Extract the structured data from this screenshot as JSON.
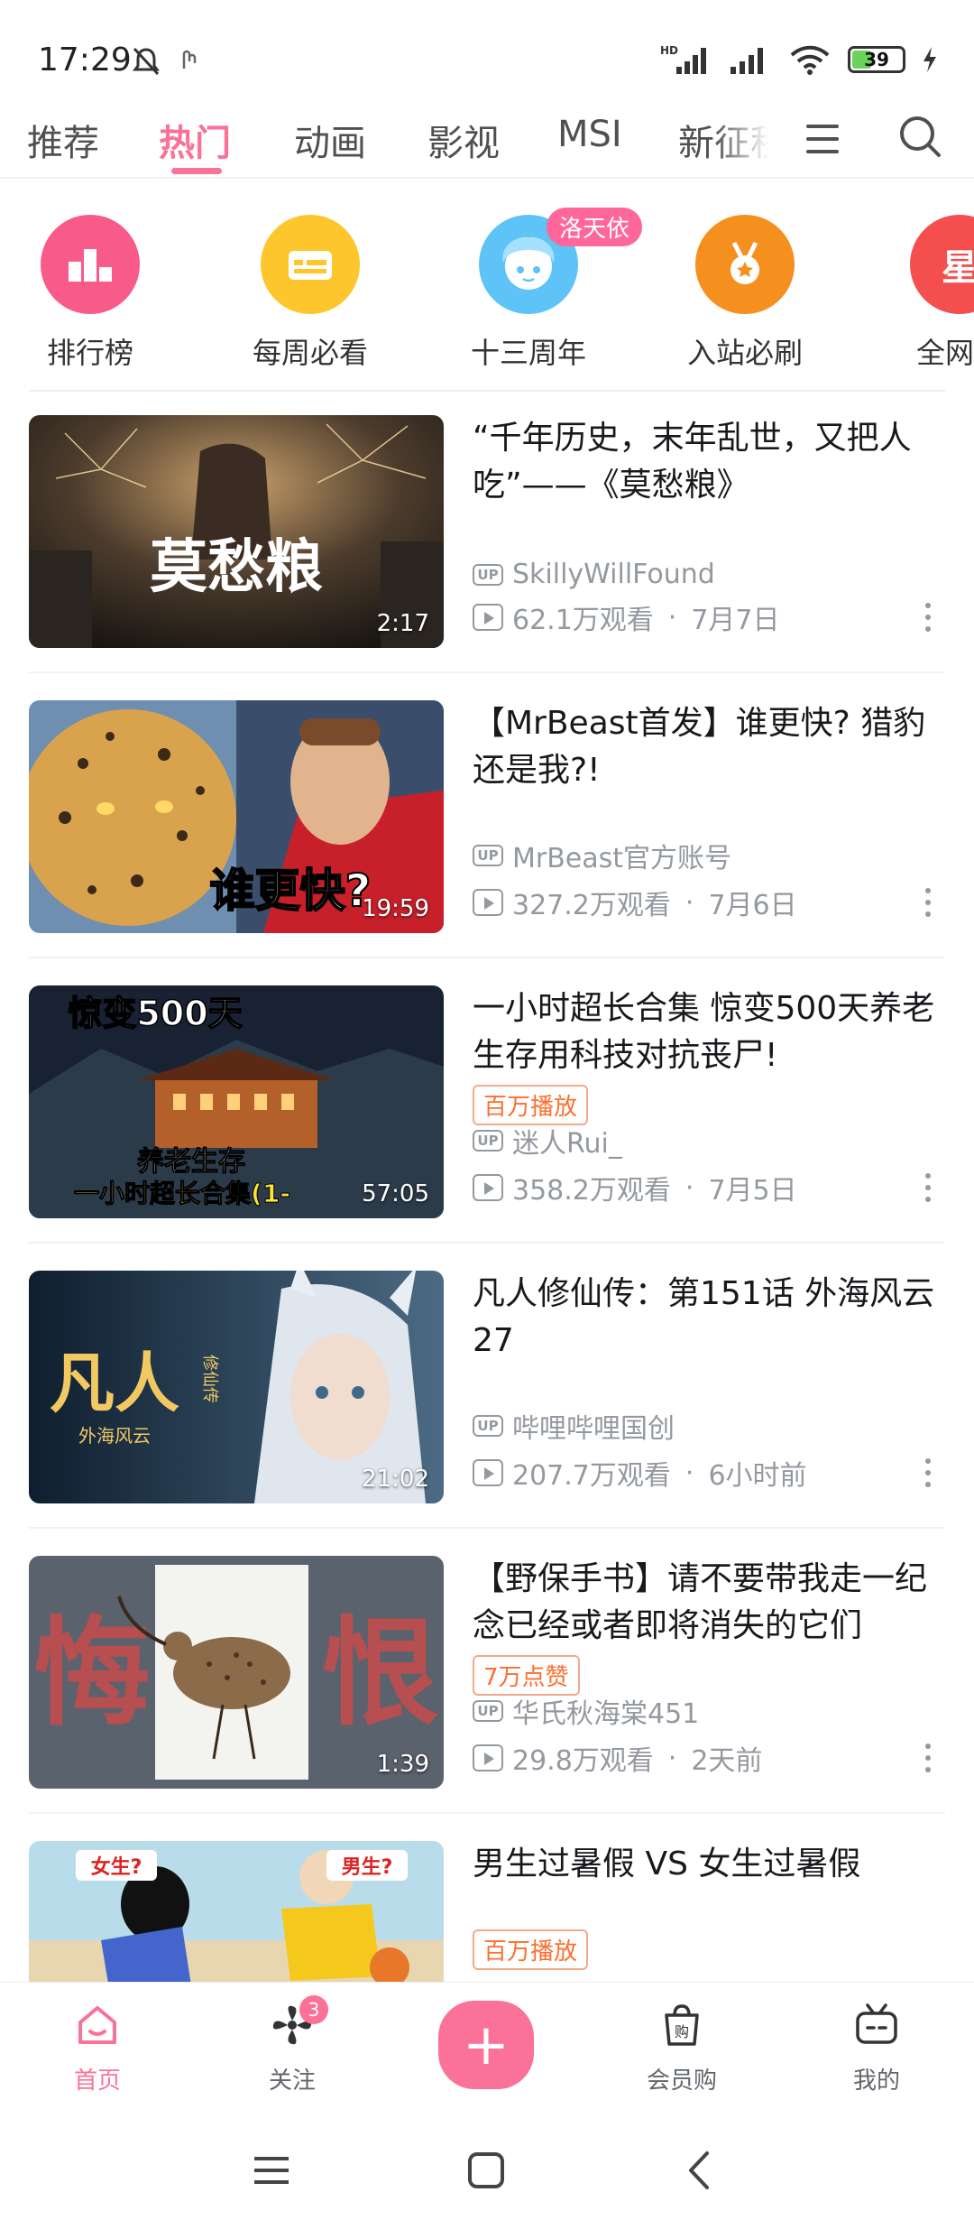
{
  "status": {
    "time": "17:29",
    "battery": "39",
    "network": "HD"
  },
  "tabs": [
    {
      "label": "推荐"
    },
    {
      "label": "热门"
    },
    {
      "label": "动画"
    },
    {
      "label": "影视"
    },
    {
      "label": "MSI"
    },
    {
      "label": "新征程"
    }
  ],
  "active_tab": "热门",
  "shortcuts": [
    {
      "label": "排行榜",
      "color": "#f85a89",
      "icon": "ranking-icon"
    },
    {
      "label": "每周必看",
      "color": "#fdc62d",
      "icon": "weekly-icon"
    },
    {
      "label": "十三周年",
      "color": "#5ec3f7",
      "icon": "anniversary-mascot-icon",
      "badge": "洛天依"
    },
    {
      "label": "入站必刷",
      "color": "#f5901f",
      "icon": "medal-icon"
    },
    {
      "label": "全网热",
      "color": "#f44e4e",
      "icon": "star-icon",
      "icon_text": "星"
    }
  ],
  "videos": [
    {
      "title": "“千年历史，末年乱世，又把人吃”——《莫愁粮》",
      "thumb_text": "莫愁粮",
      "duration": "2:17",
      "uploader": "SkillyWillFound",
      "views": "62.1万观看",
      "date": "7月7日",
      "tag": ""
    },
    {
      "title": "【MrBeast首发】谁更快? 猎豹还是我?!",
      "thumb_text": "谁更快?",
      "duration": "19:59",
      "uploader": "MrBeast官方账号",
      "views": "327.2万观看",
      "date": "7月6日",
      "tag": ""
    },
    {
      "title": "一小时超长合集 惊变500天养老生存用科技对抗丧尸!",
      "thumb_text": "惊变500天",
      "thumb_text2": "养老生存",
      "thumb_text3": "一小时超长合集(1-",
      "duration": "57:05",
      "uploader": "迷人Rui_",
      "views": "358.2万观看",
      "date": "7月5日",
      "tag": "百万播放"
    },
    {
      "title": "凡人修仙传：第151话 外海风云27",
      "thumb_text": "凡人",
      "thumb_text2": "外海风云",
      "thumb_text3": "修仙传",
      "duration": "21:02",
      "uploader": "哔哩哔哩国创",
      "views": "207.7万观看",
      "date": "6小时前",
      "tag": ""
    },
    {
      "title": "【野保手书】请不要带我走一纪念已经或者即将消失的它们",
      "thumb_text": "悔",
      "thumb_text2": "恨",
      "duration": "1:39",
      "uploader": "华氏秋海棠451",
      "views": "29.8万观看",
      "date": "2天前",
      "tag": "7万点赞"
    },
    {
      "title": "男生过暑假 VS 女生过暑假",
      "thumb_text": "女生?",
      "thumb_text2": "男生?",
      "duration": "",
      "uploader": "",
      "views": "",
      "date": "",
      "tag": "百万播放"
    }
  ],
  "bottom_nav": [
    {
      "label": "首页",
      "icon": "home-icon"
    },
    {
      "label": "关注",
      "icon": "follow-icon",
      "badge": "3"
    },
    {
      "label": "",
      "icon": "publish-plus-icon"
    },
    {
      "label": "会员购",
      "icon": "shop-icon"
    },
    {
      "label": "我的",
      "icon": "tv-icon"
    }
  ],
  "colors": {
    "accent": "#fb7299",
    "tag_orange": "#ff6e2e",
    "meta_gray": "#9499a0"
  }
}
